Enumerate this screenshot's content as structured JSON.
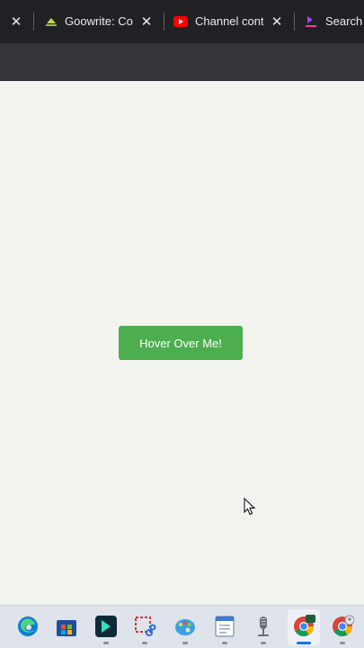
{
  "tabs": [
    {
      "title": "Goowrite: Cod"
    },
    {
      "title": "Channel conte"
    },
    {
      "title": "Search f"
    }
  ],
  "page": {
    "button_label": "Hover Over Me!"
  },
  "colors": {
    "button_bg": "#4cae4f",
    "page_bg": "#f2f2ef",
    "tabbar_bg": "#202124"
  },
  "taskbar": {
    "icons": [
      "edge-icon",
      "store-icon",
      "filmora-icon",
      "snipping-tool-icon",
      "paint-icon",
      "notepad-icon",
      "microphone-icon",
      "chrome-icon",
      "chrome-profile-icon"
    ]
  }
}
